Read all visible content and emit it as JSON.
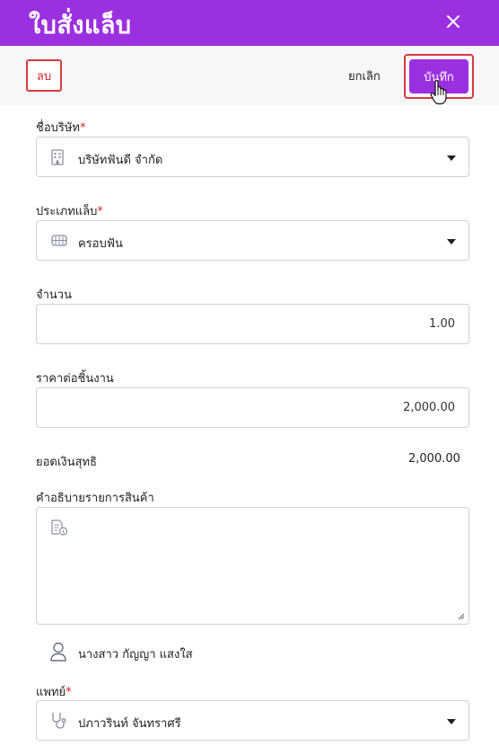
{
  "header": {
    "title": "ใบสั่งแล็บ",
    "close_icon": "close-icon"
  },
  "actions": {
    "delete_label": "ลบ",
    "cancel_label": "ยกเลิก",
    "save_label": "บันทึก"
  },
  "colors": {
    "brand": "#9b30e0",
    "danger": "#d4232b",
    "outline": "#d9393d"
  },
  "form": {
    "company": {
      "label": "ชื่อบริษัท",
      "required_mark": "*",
      "value": "บริษัทฟันดี จำกัด",
      "icon": "building-icon"
    },
    "lab_type": {
      "label": "ประเภทแล็บ",
      "required_mark": "*",
      "value": "ครอบฟัน",
      "icon": "teeth-icon"
    },
    "quantity": {
      "label": "จำนวน",
      "value": "1.00"
    },
    "unit_price": {
      "label": "ราคาต่อชิ้นงาน",
      "value": "2,000.00"
    },
    "net_total": {
      "label": "ยอดเงินสุทธิ",
      "value": "2,000.00"
    },
    "description": {
      "label": "คำอธิบายรายการสินค้า",
      "value": "",
      "icon": "document-info-icon"
    },
    "patient": {
      "name": "นางสาว กัญญา แสงใส",
      "icon": "user-icon"
    },
    "doctor": {
      "label": "แพทย์",
      "required_mark": "*",
      "value": "ปภาวรินท์ จันทราศรี",
      "icon": "stethoscope-icon"
    }
  }
}
